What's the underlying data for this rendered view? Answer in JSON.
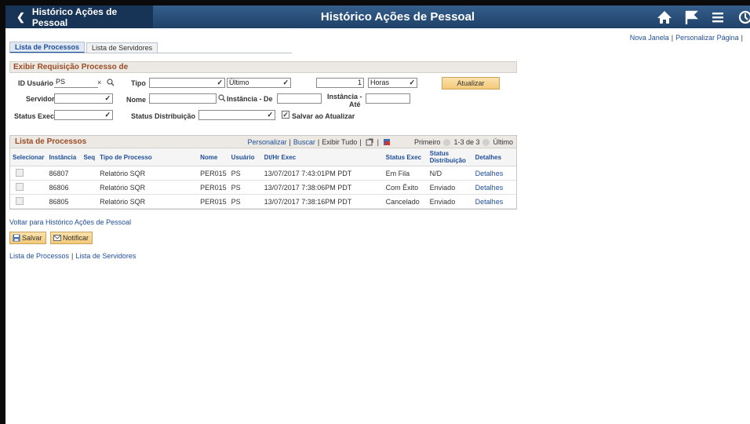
{
  "header": {
    "back_label": "Histórico Ações de Pessoal",
    "title": "Histórico Ações de Pessoal"
  },
  "toplinks": {
    "new_window": "Nova Janela",
    "personalize": "Personalizar Página"
  },
  "tabs": [
    {
      "label": "Lista de Processos",
      "active": true
    },
    {
      "label": "Lista de Servidores",
      "active": false
    }
  ],
  "filters": {
    "section_title": "Exibir Requisição Processo de",
    "user_id_label": "ID Usuário",
    "user_id_value": "PS",
    "clear_glyph": "×",
    "type_label": "Tipo",
    "type_value": "",
    "last_value": "Último",
    "amount_value": "1",
    "unit_value": "Horas",
    "refresh_button": "Atualizar",
    "server_label": "Servidor",
    "server_value": "",
    "name_label": "Nome",
    "name_value": "",
    "instance_from_label": "Instância - De",
    "instance_from_value": "",
    "instance_to_label_1": "Instância -",
    "instance_to_label_2": "Até",
    "instance_to_value": "",
    "status_exec_label": "Status Exec",
    "status_exec_value": "",
    "status_dist_label": "Status Distribuição",
    "status_dist_value": "",
    "save_on_refresh_label": "Salvar ao Atualizar",
    "save_on_refresh_checked": true
  },
  "grid": {
    "title": "Lista de Processos",
    "nav_personalize": "Personalizar",
    "nav_search": "Buscar",
    "nav_show_all": "Exibir Tudo",
    "nav_first": "Primeiro",
    "nav_range": "1-3 de 3",
    "nav_last": "Último",
    "columns": [
      "Selecionar",
      "Instância",
      "Seq",
      "Tipo de Processo",
      "Nome",
      "Usuário",
      "Dt/Hr Exec",
      "Status Exec",
      "Status Distribuição",
      "Detalhes"
    ],
    "rows": [
      {
        "instance": "86807",
        "seq": "",
        "type": "Relatório SQR",
        "name": "PER015",
        "user": "PS",
        "datetime": "13/07/2017  7:43:01PM PDT",
        "status": "Em Fila",
        "dist": "N/D",
        "details": "Detalhes"
      },
      {
        "instance": "86806",
        "seq": "",
        "type": "Relatório SQR",
        "name": "PER015",
        "user": "PS",
        "datetime": "13/07/2017  7:38:06PM PDT",
        "status": "Com Êxito",
        "dist": "Enviado",
        "details": "Detalhes"
      },
      {
        "instance": "86805",
        "seq": "",
        "type": "Relatório SQR",
        "name": "PER015",
        "user": "PS",
        "datetime": "13/07/2017  7:38:16PM PDT",
        "status": "Cancelado",
        "dist": "Enviado",
        "details": "Detalhes"
      }
    ]
  },
  "back_link": "Voltar para Histórico Ações de Pessoal",
  "actions": {
    "save": "Salvar",
    "notify": "Notificar"
  },
  "bottom_links": {
    "processes": "Lista de Processos",
    "servers": "Lista de Servidores"
  },
  "colors": {
    "header": "#2a5078",
    "link": "#1f4e99",
    "section_title": "#9a4b24",
    "button": "#f3c978"
  }
}
